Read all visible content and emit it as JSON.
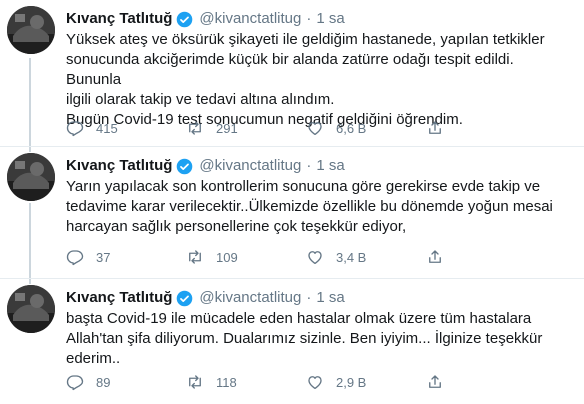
{
  "tweets": [
    {
      "name": "Kıvanç Tatlıtuğ",
      "handle": "@kivanctatlitug",
      "separator": "·",
      "time": "1 sa",
      "text": "Yüksek ateş ve öksürük şikayeti ile geldiğim hastanede, yapılan tetkikler\nsonucunda akciğerimde küçük bir alanda zatürre odağı tespit edildi. Bununla\nilgili olarak takip ve tedavi altına alındım.\nBugün Covid-19 test sonucumun negatif geldiğini öğrendim.",
      "replies": "415",
      "retweets": "291",
      "likes": "6,6 B"
    },
    {
      "name": "Kıvanç Tatlıtuğ",
      "handle": "@kivanctatlitug",
      "separator": "·",
      "time": "1 sa",
      "text": "Yarın yapılacak son kontrollerim sonucuna göre gerekirse evde takip ve\ntedavime karar verilecektir..Ülkemizde özellikle bu dönemde yoğun mesai\nharcayan sağlık personellerine çok teşekkür ediyor,",
      "replies": "37",
      "retweets": "109",
      "likes": "3,4 B"
    },
    {
      "name": "Kıvanç Tatlıtuğ",
      "handle": "@kivanctatlitug",
      "separator": "·",
      "time": "1 sa",
      "text": "başta Covid-19 ile mücadele eden hastalar olmak üzere tüm hastalara\nAllah'tan şifa diliyorum. Dualarımız sizinle. Ben iyiyim... İlginize teşekkür\nederim..",
      "replies": "89",
      "retweets": "118",
      "likes": "2,9 B"
    }
  ],
  "colors": {
    "text_primary": "#14171a",
    "text_secondary": "#657786",
    "verified_blue": "#1da1f2",
    "thread_line": "#ccd6dd",
    "divider": "#e6ecf0"
  },
  "icons": {
    "reply": "reply-icon",
    "retweet": "retweet-icon",
    "like": "like-icon",
    "share": "share-icon",
    "verified": "verified-badge-icon"
  }
}
